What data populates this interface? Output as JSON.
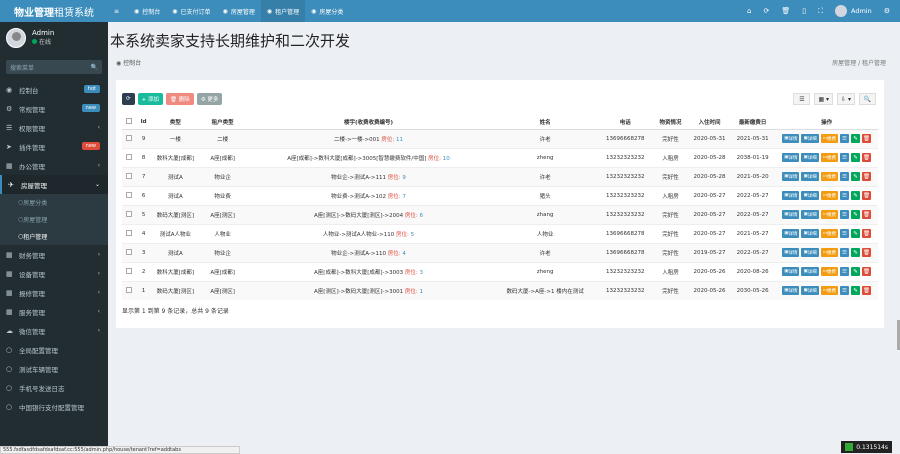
{
  "app": {
    "logo_bold": "物业管理",
    "logo_thin": "租赁系统",
    "user": "Admin",
    "status": "在线",
    "search_placeholder": "搜索菜单"
  },
  "sidebar": [
    {
      "icon": "dashboard-icon",
      "glyph": "◉",
      "label": "控制台",
      "badge": "hot",
      "badge_color": "#3c8dbc",
      "arrow": ""
    },
    {
      "icon": "settings-icon",
      "glyph": "⚙",
      "label": "常规管理",
      "badge": "new",
      "badge_color": "#3c8dbc",
      "arrow": ""
    },
    {
      "icon": "users-icon",
      "glyph": "☰",
      "label": "权限管理",
      "badge": "",
      "arrow": "‹"
    },
    {
      "icon": "paper-plane-icon",
      "glyph": "➤",
      "label": "插件管理",
      "badge": "new",
      "badge_color": "#dd4b39",
      "arrow": ""
    },
    {
      "icon": "office-icon",
      "glyph": "▦",
      "label": "办公管理",
      "badge": "",
      "arrow": "‹"
    },
    {
      "icon": "house-icon",
      "glyph": "✈",
      "label": "房屋管理",
      "badge": "",
      "arrow": "⌄",
      "active": true
    }
  ],
  "sidebar_sub": [
    "房屋分类",
    "房屋管理",
    "租户管理"
  ],
  "sidebar_sub_on": 2,
  "sidebar_more": [
    {
      "icon": "finance-icon",
      "glyph": "▦",
      "label": "财务管理",
      "arrow": "‹"
    },
    {
      "icon": "device-icon",
      "glyph": "▦",
      "label": "设备管理",
      "arrow": "‹"
    },
    {
      "icon": "repair-icon",
      "glyph": "▦",
      "label": "报修管理",
      "arrow": "‹"
    },
    {
      "icon": "service-icon",
      "glyph": "▦",
      "label": "服务管理",
      "arrow": "‹"
    },
    {
      "icon": "wechat-icon",
      "glyph": "☁",
      "label": "微信管理",
      "arrow": "‹"
    },
    {
      "icon": "circle-icon",
      "glyph": "○",
      "label": "全局配置管理",
      "arrow": ""
    },
    {
      "icon": "circle-icon",
      "glyph": "○",
      "label": "测试车辆管理",
      "arrow": ""
    },
    {
      "icon": "circle-icon",
      "glyph": "○",
      "label": "手机号发送日志",
      "arrow": ""
    },
    {
      "icon": "circle-icon",
      "glyph": "○",
      "label": "中国银行支付配置管理",
      "arrow": ""
    }
  ],
  "topbar": {
    "tabs": [
      {
        "label": "",
        "glyph": "≡",
        "name": "menu-toggle"
      },
      {
        "label": "控制台",
        "glyph": "◉",
        "name": "tab-dashboard"
      },
      {
        "label": "已支付订单",
        "glyph": "◉",
        "name": "tab-paid-orders"
      },
      {
        "label": "房屋管理",
        "glyph": "◉",
        "name": "tab-house"
      },
      {
        "label": "租户管理",
        "glyph": "◉",
        "name": "tab-tenant",
        "sel": true
      },
      {
        "label": "房屋分类",
        "glyph": "◉",
        "name": "tab-category"
      }
    ],
    "right_icons": [
      "home-icon",
      "refresh-icon",
      "trash-icon",
      "mobile-icon",
      "fullscreen-icon"
    ],
    "user": "Admin"
  },
  "page": {
    "heading": "本系统卖家支持长期维护和二次开发",
    "crumb_left": "控制台",
    "crumb_right": "房屋管理  /  租户管理"
  },
  "toolbar": {
    "refresh": "⟳",
    "add": "+ 添加",
    "del": "🗑 删除",
    "more": "⚙ 更多"
  },
  "table": {
    "headers": [
      "",
      "Id",
      "类型",
      "租户类型",
      "楼宇(收费收费编号)",
      "姓名",
      "电话",
      "物资情况",
      "入住时间",
      "最新缴费日",
      "操作"
    ],
    "rows": [
      {
        "id": "9",
        "type": "一楼",
        "ttype": "二楼",
        "path": "二楼->一楼->001",
        "pre": "房位:",
        "num": "11",
        "name": "许老",
        "phone": "13696668278",
        "cond": "完好性",
        "in": "2020-05-31",
        "pay": "2021-05-31"
      },
      {
        "id": "8",
        "type": "数科大厦[成都]",
        "ttype": "A座[成都]",
        "path": "A座[成都]->数科大厦[成都]->3005[智慧缴费软件/中国]",
        "pre": "房位:",
        "num": "10",
        "name": "zheng",
        "phone": "13232323232",
        "cond": "入租房",
        "in": "2020-05-28",
        "pay": "2038-01-19"
      },
      {
        "id": "7",
        "type": "测试A",
        "ttype": "物业企",
        "path": "物业企->测试A->111",
        "pre": "房位:",
        "num": "9",
        "name": "许老",
        "phone": "13232323232",
        "cond": "完好性",
        "in": "2020-05-28",
        "pay": "2021-05-20"
      },
      {
        "id": "6",
        "type": "测试A",
        "ttype": "物业费",
        "path": "物业费->测试A->102",
        "pre": "房位:",
        "num": "7",
        "name": "猪头",
        "phone": "13232323232",
        "cond": "入租房",
        "in": "2020-05-27",
        "pay": "2022-05-27"
      },
      {
        "id": "5",
        "type": "数码大厦[测区]",
        "ttype": "A座[测区]",
        "path": "A座[测区]->数码大厦[测区]->2004",
        "pre": "房位:",
        "num": "6",
        "name": "zhang",
        "phone": "13232323232",
        "cond": "完好性",
        "in": "2020-05-27",
        "pay": "2022-05-27"
      },
      {
        "id": "4",
        "type": "测试A人物业",
        "ttype": "人物业",
        "path": "人物业->测试A人物业->110",
        "pre": "房位:",
        "num": "5",
        "name": "人物业",
        "phone": "13696668278",
        "cond": "完好性",
        "in": "2020-05-27",
        "pay": "2021-05-27"
      },
      {
        "id": "3",
        "type": "测试A",
        "ttype": "物业企",
        "path": "物业企->测试A->110",
        "pre": "房位:",
        "num": "4",
        "name": "许老",
        "phone": "13696668278",
        "cond": "完好性",
        "in": "2019-05-27",
        "pay": "2022-05-27"
      },
      {
        "id": "2",
        "type": "数科大厦[成都]",
        "ttype": "A座[成都]",
        "path": "A座[成都]->数科大厦[成都]->3003",
        "pre": "房位:",
        "num": "3",
        "name": "zheng",
        "phone": "13232323232",
        "cond": "入租房",
        "in": "2020-05-26",
        "pay": "2020-08-26"
      },
      {
        "id": "1",
        "type": "数码大厦[测区]",
        "ttype": "A座[测区]",
        "path": "A座[测区]->数码大厦[测区]->3001",
        "pre": "房位:",
        "num": "1",
        "name": "数码大厦->A座->1 楼内在测试",
        "phone": "13232323232",
        "cond": "完好性",
        "in": "2020-05-26",
        "pay": "2030-05-26"
      }
    ],
    "ops": {
      "detail": "详情",
      "detail2": "详细",
      "bill": "缴费"
    }
  },
  "pageinfo": "显示第 1 到第 9 条记录，总共 9 条记录",
  "statusbar": "555.fsdfasdfdsafdsafdsaf.cc:555/admin.php/house/tenant?ref=addtabs",
  "timer": "0.131514s",
  "colors": {
    "primary": "#3c8dbc",
    "sidebar": "#222d32",
    "green": "#00a65a",
    "red": "#dd4b39",
    "orange": "#f39c12",
    "blue": "#3c8dbc",
    "purple": "#605ca8",
    "darkblue": "#0073b7"
  }
}
